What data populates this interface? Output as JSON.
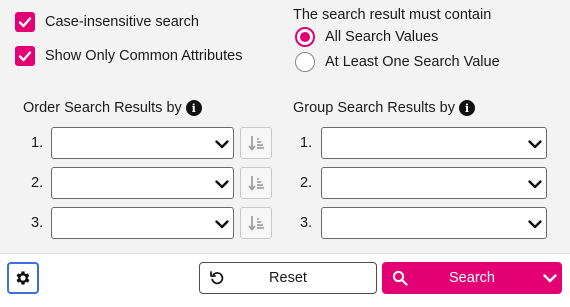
{
  "options": {
    "case_insensitive": {
      "label": "Case-insensitive search",
      "checked": true
    },
    "common_attributes": {
      "label": "Show Only Common Attributes",
      "checked": true
    }
  },
  "match_mode": {
    "title": "The search result must contain",
    "options": [
      {
        "label": "All Search Values",
        "selected": true
      },
      {
        "label": "At Least One Search Value",
        "selected": false
      }
    ]
  },
  "order_by": {
    "title": "Order Search Results by",
    "rows": [
      {
        "number": "1.",
        "value": ""
      },
      {
        "number": "2.",
        "value": ""
      },
      {
        "number": "3.",
        "value": ""
      }
    ]
  },
  "group_by": {
    "title": "Group Search Results by",
    "rows": [
      {
        "number": "1.",
        "value": ""
      },
      {
        "number": "2.",
        "value": ""
      },
      {
        "number": "3.",
        "value": ""
      }
    ]
  },
  "footer": {
    "settings_icon": "gear-icon",
    "reset_label": "Reset",
    "search_label": "Search"
  },
  "colors": {
    "accent": "#e20074",
    "focus": "#3f6fd8",
    "panel_bg": "#f3f3f3"
  }
}
